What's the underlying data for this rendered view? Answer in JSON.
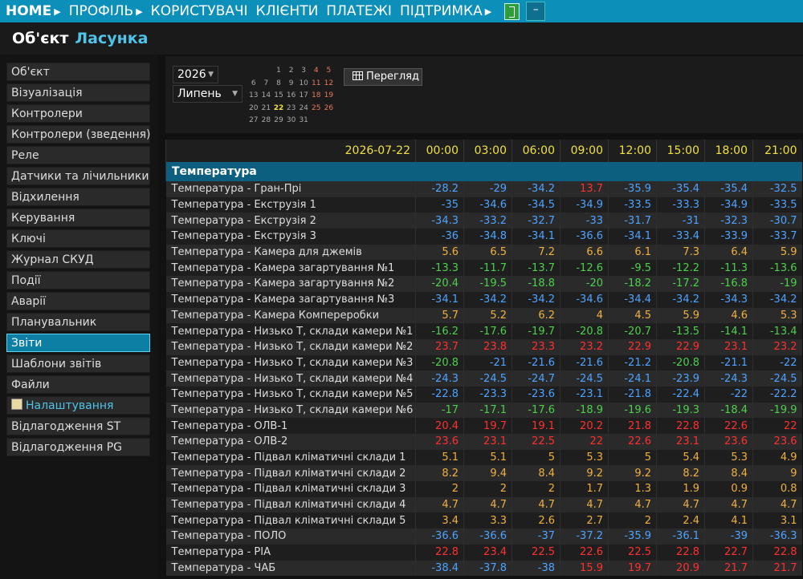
{
  "nav": {
    "items": [
      {
        "label": "HOME",
        "arrow": true,
        "home": true
      },
      {
        "label": "ПРОФІЛЬ",
        "arrow": true
      },
      {
        "label": "КОРИСТУВАЧІ",
        "arrow": false
      },
      {
        "label": "КЛІЄНТИ",
        "arrow": false
      },
      {
        "label": "ПЛАТЕЖІ",
        "arrow": false
      },
      {
        "label": "ПІДТРИМКА",
        "arrow": true
      }
    ],
    "minimize_label": "–"
  },
  "header": {
    "prefix": "Об'єкт",
    "name": "Ласунка"
  },
  "sidebar": {
    "items": [
      {
        "label": "Об'єкт"
      },
      {
        "label": "Візуалізація"
      },
      {
        "label": "Контролери"
      },
      {
        "label": "Контролери (зведення)"
      },
      {
        "label": "Реле"
      },
      {
        "label": "Датчики та лічильники"
      },
      {
        "label": "Відхилення"
      },
      {
        "label": "Керування"
      },
      {
        "label": "Ключі"
      },
      {
        "label": "Журнал СКУД"
      },
      {
        "label": "Події"
      },
      {
        "label": "Аварії"
      },
      {
        "label": "Планувальник"
      },
      {
        "label": "Звіти",
        "active": true
      },
      {
        "label": "Шаблони звітів"
      },
      {
        "label": "Файли"
      },
      {
        "label": "Налаштування",
        "special": true
      },
      {
        "label": "Відлагодження ST"
      },
      {
        "label": "Відлагодження PG"
      }
    ]
  },
  "controls": {
    "year": "2026",
    "month": "Липень",
    "view_button": "Перегляд",
    "calendar": [
      [
        "",
        "",
        "1",
        "2",
        "3",
        "4",
        "5"
      ],
      [
        "6",
        "7",
        "8",
        "9",
        "10",
        "11",
        "12"
      ],
      [
        "13",
        "14",
        "15",
        "16",
        "17",
        "18",
        "19"
      ],
      [
        "20",
        "21",
        "22",
        "23",
        "24",
        "25",
        "26"
      ],
      [
        "27",
        "28",
        "29",
        "30",
        "31",
        "",
        ""
      ]
    ],
    "today": "22"
  },
  "table": {
    "date": "2026-07-22",
    "times": [
      "00:00",
      "03:00",
      "06:00",
      "09:00",
      "12:00",
      "15:00",
      "18:00",
      "21:00"
    ],
    "section": "Температура",
    "rows": [
      {
        "label": "Температура - Гран-Прі",
        "values": [
          "-28.2",
          "-29",
          "-34.2",
          "13.7",
          "-35.9",
          "-35.4",
          "-35.4",
          "-32.5"
        ]
      },
      {
        "label": "Температура - Екструзія 1",
        "values": [
          "-35",
          "-34.6",
          "-34.5",
          "-34.9",
          "-33.5",
          "-33.3",
          "-34.9",
          "-33.5"
        ]
      },
      {
        "label": "Температура - Екструзія 2",
        "values": [
          "-34.3",
          "-33.2",
          "-32.7",
          "-33",
          "-31.7",
          "-31",
          "-32.3",
          "-30.7"
        ]
      },
      {
        "label": "Температура - Екструзія 3",
        "values": [
          "-36",
          "-34.8",
          "-34.1",
          "-36.6",
          "-34.1",
          "-33.4",
          "-33.9",
          "-33.7"
        ]
      },
      {
        "label": "Температура - Камера для джемів",
        "values": [
          "5.6",
          "6.5",
          "7.2",
          "6.6",
          "6.1",
          "7.3",
          "6.4",
          "5.9"
        ]
      },
      {
        "label": "Температура - Камера загартування №1",
        "values": [
          "-13.3",
          "-11.7",
          "-13.7",
          "-12.6",
          "-9.5",
          "-12.2",
          "-11.3",
          "-13.6"
        ]
      },
      {
        "label": "Температура - Камера загартування №2",
        "values": [
          "-20.4",
          "-19.5",
          "-18.8",
          "-20",
          "-18.2",
          "-17.2",
          "-16.8",
          "-19"
        ]
      },
      {
        "label": "Температура - Камера загартування №3",
        "values": [
          "-34.1",
          "-34.2",
          "-34.2",
          "-34.6",
          "-34.4",
          "-34.2",
          "-34.3",
          "-34.2"
        ]
      },
      {
        "label": "Температура - Камера Компеpеробки",
        "values": [
          "5.7",
          "5.2",
          "6.2",
          "4",
          "4.5",
          "5.9",
          "4.6",
          "5.3"
        ]
      },
      {
        "label": "Температура - Низько Т, склади камери №1",
        "values": [
          "-16.2",
          "-17.6",
          "-19.7",
          "-20.8",
          "-20.7",
          "-13.5",
          "-14.1",
          "-13.4"
        ]
      },
      {
        "label": "Температура - Низько Т, склади камери №2",
        "values": [
          "23.7",
          "23.8",
          "23.3",
          "23.2",
          "22.9",
          "22.9",
          "23.1",
          "23.2"
        ]
      },
      {
        "label": "Температура - Низько Т, склади камери №3",
        "values": [
          "-20.8",
          "-21",
          "-21.6",
          "-21.6",
          "-21.2",
          "-20.8",
          "-21.1",
          "-22"
        ]
      },
      {
        "label": "Температура - Низько Т, склади камери №4",
        "values": [
          "-24.3",
          "-24.5",
          "-24.7",
          "-24.5",
          "-24.1",
          "-23.9",
          "-24.3",
          "-24.5"
        ]
      },
      {
        "label": "Температура - Низько Т, склади камери №5",
        "values": [
          "-22.8",
          "-23.3",
          "-23.6",
          "-23.1",
          "-21.8",
          "-22.4",
          "-22",
          "-22.2"
        ]
      },
      {
        "label": "Температура - Низько Т, склади камери №6",
        "values": [
          "-17",
          "-17.1",
          "-17.6",
          "-18.9",
          "-19.6",
          "-19.3",
          "-18.4",
          "-19.9"
        ]
      },
      {
        "label": "Температура - ОЛВ-1",
        "values": [
          "20.4",
          "19.7",
          "19.1",
          "20.2",
          "21.8",
          "22.8",
          "22.6",
          "22"
        ]
      },
      {
        "label": "Температура - ОЛВ-2",
        "values": [
          "23.6",
          "23.1",
          "22.5",
          "22",
          "22.6",
          "23.1",
          "23.6",
          "23.6"
        ]
      },
      {
        "label": "Температура - Підвал кліматичні склади 1",
        "values": [
          "5.1",
          "5.1",
          "5",
          "5.3",
          "5",
          "5.4",
          "5.3",
          "4.9"
        ]
      },
      {
        "label": "Температура - Підвал кліматичні склади 2",
        "values": [
          "8.2",
          "9.4",
          "8.4",
          "9.2",
          "9.2",
          "8.2",
          "8.4",
          "9"
        ]
      },
      {
        "label": "Температура - Підвал кліматичні склади 3",
        "values": [
          "2",
          "2",
          "2",
          "1.7",
          "1.3",
          "1.9",
          "0.9",
          "0.8"
        ]
      },
      {
        "label": "Температура - Підвал кліматичні склади 4",
        "values": [
          "4.7",
          "4.7",
          "4.7",
          "4.7",
          "4.7",
          "4.7",
          "4.7",
          "4.7"
        ]
      },
      {
        "label": "Температура - Підвал кліматичні склади 5",
        "values": [
          "3.4",
          "3.3",
          "2.6",
          "2.7",
          "2",
          "2.4",
          "4.1",
          "3.1"
        ]
      },
      {
        "label": "Температура - ПОЛО",
        "values": [
          "-36.6",
          "-36.6",
          "-37",
          "-37.2",
          "-35.9",
          "-36.1",
          "-39",
          "-36.3"
        ]
      },
      {
        "label": "Температура - PIA",
        "values": [
          "22.8",
          "23.4",
          "22.5",
          "22.6",
          "22.5",
          "22.8",
          "22.7",
          "22.8"
        ]
      },
      {
        "label": "Температура - ЧАБ",
        "values": [
          "-38.4",
          "-37.8",
          "-38",
          "15.9",
          "19.7",
          "20.9",
          "21.7",
          "21.7"
        ]
      }
    ]
  },
  "colors": {
    "accent": "#0c8fb8",
    "section": "#0d5f80",
    "header_text": "#f0e040",
    "negative_cold": "#4da3ff",
    "negative_mild": "#4cd04c",
    "positive_low": "#f0b040",
    "positive_high": "#ff3030"
  }
}
